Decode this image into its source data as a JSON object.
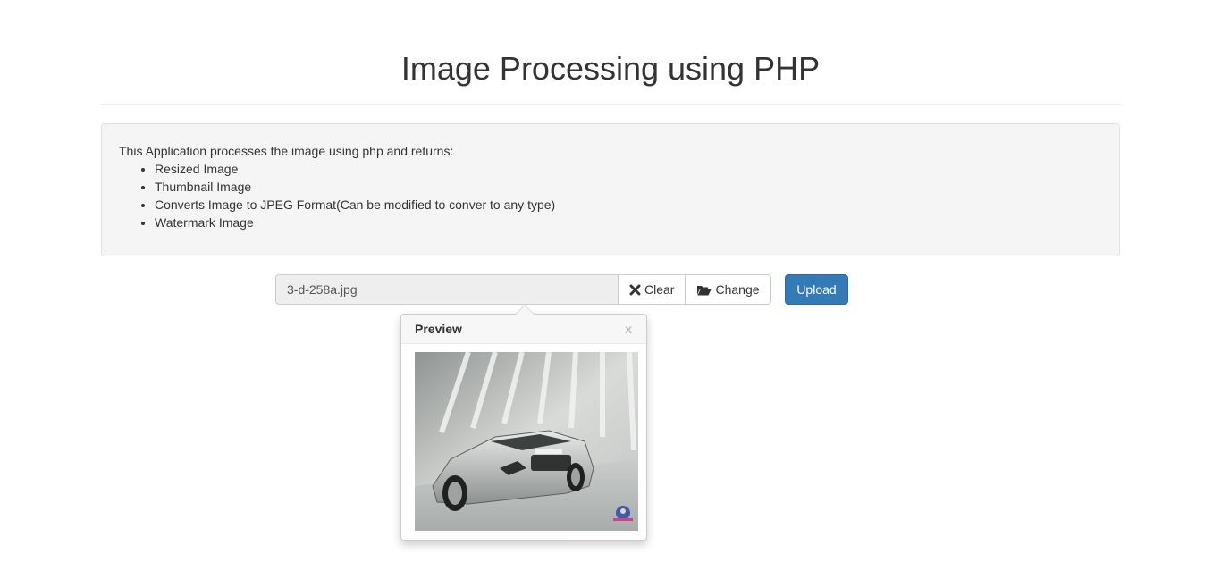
{
  "page": {
    "title": "Image Processing using PHP"
  },
  "info": {
    "intro": "This Application processes the image using php and returns:",
    "items": [
      "Resized Image",
      "Thumbnail Image",
      "Converts Image to JPEG Format(Can be modified to conver to any type)",
      "Watermark Image"
    ]
  },
  "file_input": {
    "caption": "3-d-258a.jpg",
    "clear_label": "Clear",
    "clear_icon": "times-icon",
    "change_label": "Change",
    "change_icon": "folder-open-icon"
  },
  "upload": {
    "label": "Upload",
    "color": "#337ab7"
  },
  "preview": {
    "title": "Preview",
    "close_label": "x"
  }
}
